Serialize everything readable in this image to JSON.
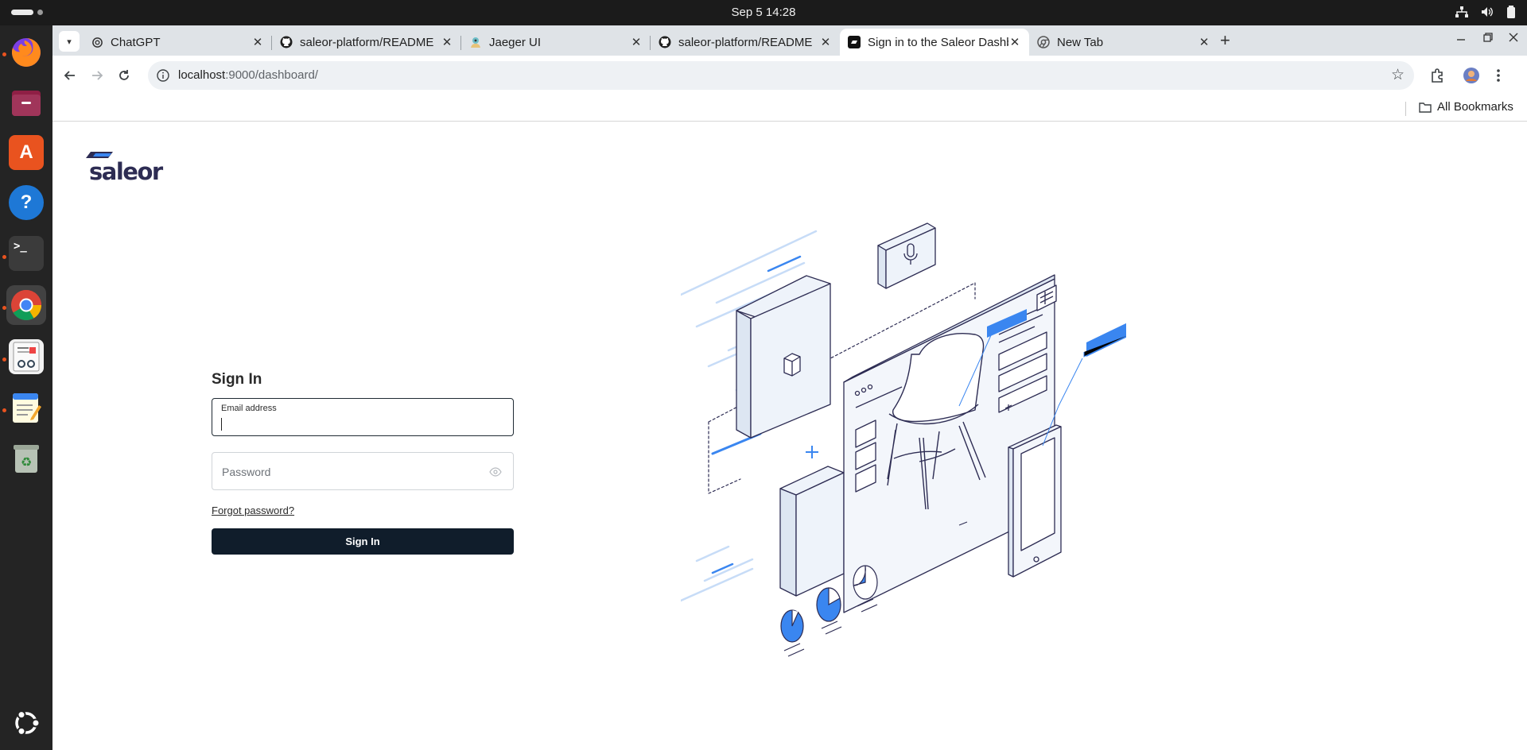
{
  "system": {
    "clock": "Sep 5  14:28"
  },
  "browser": {
    "tabs": [
      {
        "title": "ChatGPT",
        "icon": "chatgpt-icon"
      },
      {
        "title": "saleor-platform/README",
        "icon": "github-icon"
      },
      {
        "title": "Jaeger UI",
        "icon": "jaeger-icon"
      },
      {
        "title": "saleor-platform/README",
        "icon": "github-icon"
      },
      {
        "title": "Sign in to the Saleor Dashboard",
        "icon": "saleor-icon",
        "active": true
      },
      {
        "title": "New Tab",
        "icon": "chrome-icon"
      }
    ],
    "url_host": "localhost",
    "url_path": ":9000/dashboard/",
    "bookmarks_folder": "All Bookmarks"
  },
  "page": {
    "logo_text": "saleor",
    "heading": "Sign In",
    "email_label": "Email address",
    "email_value": "",
    "password_placeholder": "Password",
    "forgot_link": "Forgot password?",
    "submit_label": "Sign In"
  },
  "colors": {
    "accent": "#3a86f0",
    "button": "#101d2b",
    "logo": "#2d2c53"
  }
}
